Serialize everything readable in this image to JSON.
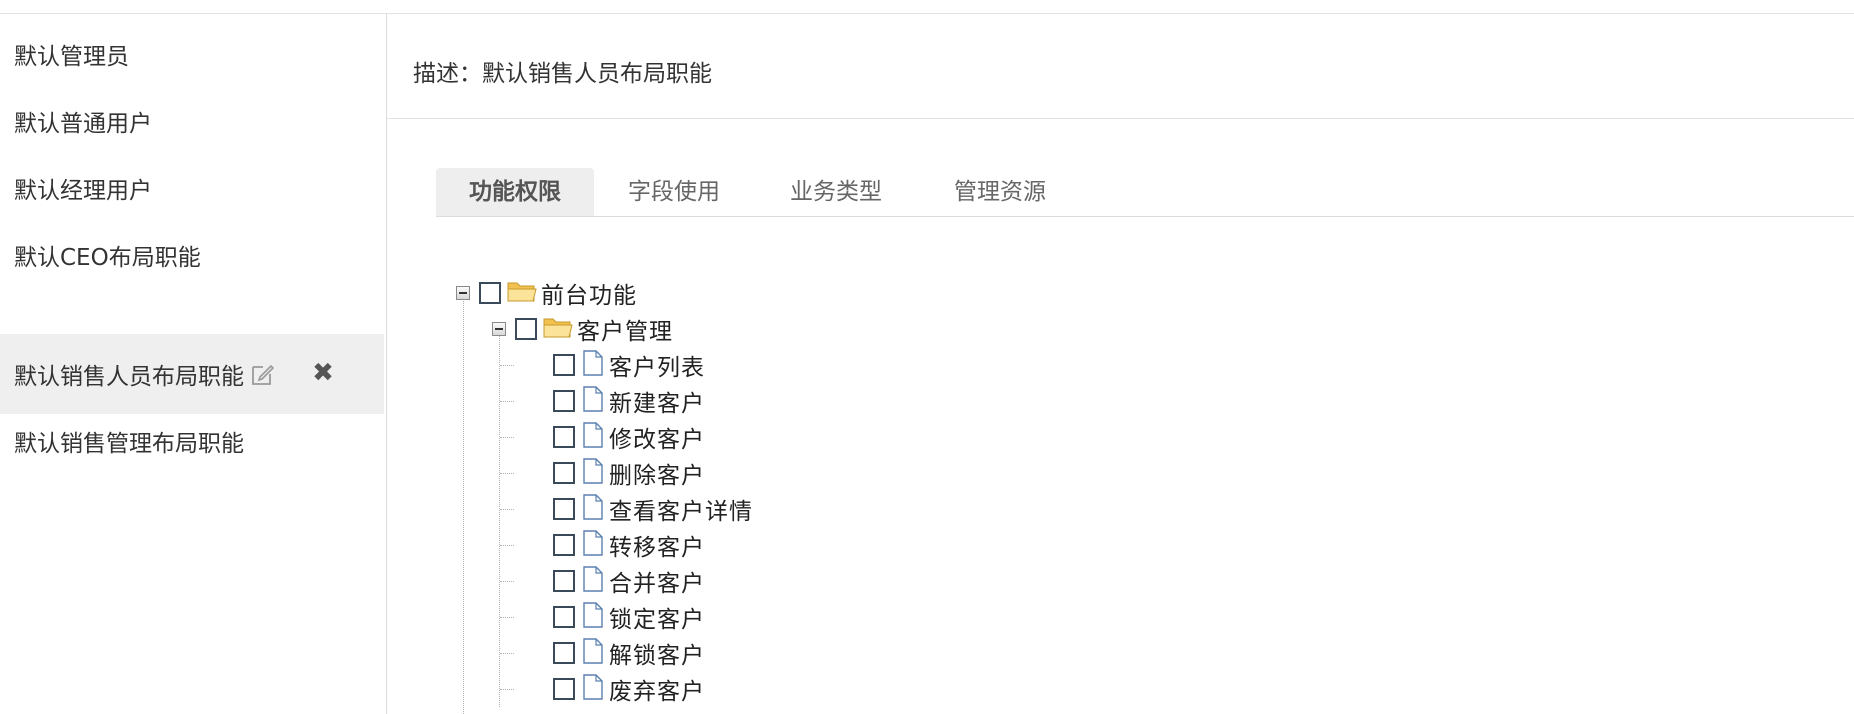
{
  "sidebar": {
    "items": [
      {
        "label": "默认管理员"
      },
      {
        "label": "默认普通用户"
      },
      {
        "label": "默认经理用户"
      },
      {
        "label": "默认CEO布局职能"
      },
      {
        "label": "默认销售人员布局职能"
      },
      {
        "label": "默认销售管理布局职能"
      }
    ],
    "active_index": 4
  },
  "main": {
    "description": "描述：默认销售人员布局职能",
    "tabs": [
      {
        "label": "功能权限"
      },
      {
        "label": "字段使用"
      },
      {
        "label": "业务类型"
      },
      {
        "label": "管理资源"
      }
    ],
    "active_tab": 0,
    "tree": {
      "root": {
        "label": "前台功能",
        "icon": "folder-open-icon",
        "expanded": true
      },
      "group": {
        "label": "客户管理",
        "icon": "folder-open-icon",
        "expanded": true
      },
      "leaves": [
        {
          "label": "客户列表"
        },
        {
          "label": "新建客户"
        },
        {
          "label": "修改客户"
        },
        {
          "label": "删除客户"
        },
        {
          "label": "查看客户详情"
        },
        {
          "label": "转移客户"
        },
        {
          "label": "合并客户"
        },
        {
          "label": "锁定客户"
        },
        {
          "label": "解锁客户"
        },
        {
          "label": "废弃客户"
        }
      ]
    }
  },
  "colors": {
    "active_row_bg": "#efefef",
    "checkbox_border": "#3b4a5a",
    "folder_fill": "#f7d774"
  }
}
